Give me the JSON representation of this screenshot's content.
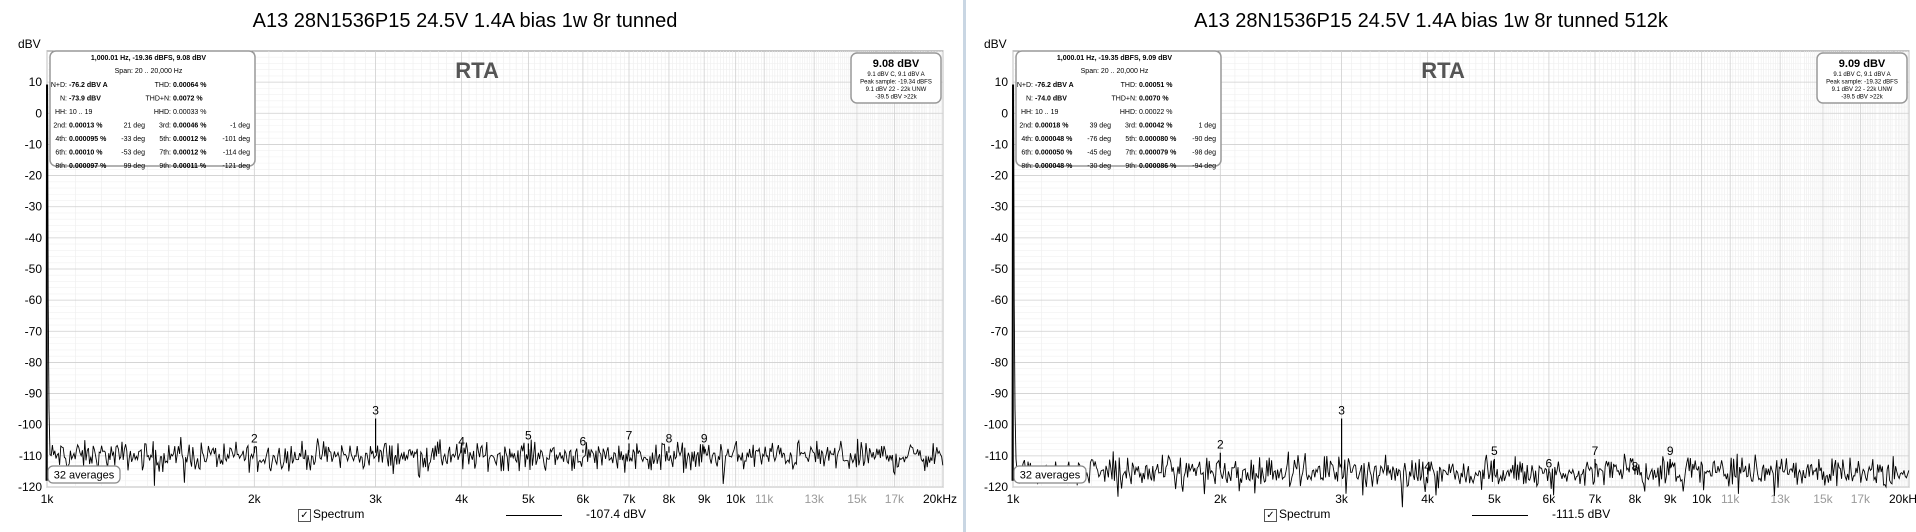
{
  "charts": [
    {
      "title": "A13 28N1536P15 24.5V 1.4A bias 1w 8r tunned",
      "unit_label": "dBV",
      "rta_label": "RTA",
      "averages_label": "32 averages",
      "spectrum_label": "Spectrum",
      "spectrum_value": "-107.4 dBV",
      "level_box": {
        "value": "9.08 dBV",
        "lines": [
          "9.1 dBV C, 9.1 dBV A",
          "Peak sample: -19.34 dBFS",
          "9.1 dBV 22 - 22k UNW",
          "-39.5 dBV >22k"
        ]
      },
      "info_box": {
        "header": "1,000.01 Hz, -19.36 dBFS, 9.08 dBV",
        "span": "Span: 20 .. 20,000 Hz",
        "rows": [
          [
            "N+D:",
            "-76.2 dBV A",
            "",
            "THD:",
            "0.00064 %",
            ""
          ],
          [
            "N:",
            "-73.9 dBV",
            "",
            "THD+N:",
            "0.0072 %",
            ""
          ],
          [
            "HH:",
            "10 .. 19",
            "",
            "HHD:",
            "0.00033 %",
            ""
          ],
          [
            "2nd:",
            "0.00013 %",
            "21 deg",
            "3rd:",
            "0.00046 %",
            "-1 deg"
          ],
          [
            "4th:",
            "0.000095 %",
            "-33 deg",
            "5th:",
            "0.00012 %",
            "-101 deg"
          ],
          [
            "6th:",
            "0.00010 %",
            "-53 deg",
            "7th:",
            "0.00012 %",
            "-114 deg"
          ],
          [
            "8th:",
            "0.000097 %",
            "99 deg",
            "9th:",
            "0.00011 %",
            "-121 deg"
          ]
        ]
      },
      "chart_data": {
        "type": "line",
        "title": "A13 28N1536P15 24.5V 1.4A bias 1w 8r tunned",
        "ylabel": "dBV",
        "ylim": [
          -120,
          20
        ],
        "xlim": [
          1000,
          20000
        ],
        "x_scale": "log",
        "grid": true,
        "y_ticks": [
          10,
          0,
          -10,
          -20,
          -30,
          -40,
          -50,
          -60,
          -70,
          -80,
          -90,
          -100,
          -110,
          -120
        ],
        "x_ticks": [
          {
            "v": 1000,
            "label": "1k",
            "major": true
          },
          {
            "v": 2000,
            "label": "2k",
            "major": true
          },
          {
            "v": 3000,
            "label": "3k",
            "major": true
          },
          {
            "v": 4000,
            "label": "4k",
            "major": true
          },
          {
            "v": 5000,
            "label": "5k",
            "major": true
          },
          {
            "v": 6000,
            "label": "6k",
            "major": true
          },
          {
            "v": 7000,
            "label": "7k",
            "major": true
          },
          {
            "v": 8000,
            "label": "8k",
            "major": true
          },
          {
            "v": 9000,
            "label": "9k",
            "major": true
          },
          {
            "v": 10000,
            "label": "10k",
            "major": true
          },
          {
            "v": 11000,
            "label": "11k",
            "major": false
          },
          {
            "v": 13000,
            "label": "13k",
            "major": false
          },
          {
            "v": 15000,
            "label": "15k",
            "major": false
          },
          {
            "v": 17000,
            "label": "17k",
            "major": false
          },
          {
            "v": 20000,
            "label": "20kHz",
            "major": true
          }
        ],
        "noise_floor_dbv": -110,
        "fundamental": {
          "x": 1000,
          "y": 9.08
        },
        "harmonics": [
          {
            "label": "2",
            "x": 2000,
            "y": -107
          },
          {
            "label": "3",
            "x": 3000,
            "y": -98
          },
          {
            "label": "4",
            "x": 4000,
            "y": -108
          },
          {
            "label": "5",
            "x": 5000,
            "y": -106
          },
          {
            "label": "6",
            "x": 6000,
            "y": -108
          },
          {
            "label": "7",
            "x": 7000,
            "y": -106
          },
          {
            "label": "8",
            "x": 8000,
            "y": -107
          },
          {
            "label": "9",
            "x": 9000,
            "y": -107
          }
        ]
      }
    },
    {
      "title": "A13 28N1536P15 24.5V 1.4A bias 1w 8r tunned 512k",
      "unit_label": "dBV",
      "rta_label": "RTA",
      "averages_label": "32 averages",
      "spectrum_label": "Spectrum",
      "spectrum_value": "-111.5 dBV",
      "level_box": {
        "value": "9.09 dBV",
        "lines": [
          "9.1 dBV C, 9.1 dBV A",
          "Peak sample: -19.32 dBFS",
          "9.1 dBV 22 - 22k UNW",
          "-39.5 dBV >22k"
        ]
      },
      "info_box": {
        "header": "1,000.01 Hz, -19.35 dBFS, 9.09 dBV",
        "span": "Span: 20 .. 20,000 Hz",
        "rows": [
          [
            "N+D:",
            "-76.2 dBV A",
            "",
            "THD:",
            "0.00051 %",
            ""
          ],
          [
            "N:",
            "-74.0 dBV",
            "",
            "THD+N:",
            "0.0070 %",
            ""
          ],
          [
            "HH:",
            "10 .. 19",
            "",
            "HHD:",
            "0.00022 %",
            ""
          ],
          [
            "2nd:",
            "0.00018 %",
            "39 deg",
            "3rd:",
            "0.00042 %",
            "1 deg"
          ],
          [
            "4th:",
            "0.000048 %",
            "-76 deg",
            "5th:",
            "0.000080 %",
            "-90 deg"
          ],
          [
            "6th:",
            "0.000050 %",
            "-45 deg",
            "7th:",
            "0.000079 %",
            "-98 deg"
          ],
          [
            "8th:",
            "0.000048 %",
            "-30 deg",
            "9th:",
            "0.000086 %",
            "-94 deg"
          ]
        ]
      },
      "chart_data": {
        "type": "line",
        "title": "A13 28N1536P15 24.5V 1.4A bias 1w 8r tunned 512k",
        "ylabel": "dBV",
        "ylim": [
          -120,
          20
        ],
        "xlim": [
          1000,
          20000
        ],
        "x_scale": "log",
        "grid": true,
        "y_ticks": [
          10,
          0,
          -10,
          -20,
          -30,
          -40,
          -50,
          -60,
          -70,
          -80,
          -90,
          -100,
          -110,
          -120
        ],
        "x_ticks": [
          {
            "v": 1000,
            "label": "1k",
            "major": true
          },
          {
            "v": 2000,
            "label": "2k",
            "major": true
          },
          {
            "v": 3000,
            "label": "3k",
            "major": true
          },
          {
            "v": 4000,
            "label": "4k",
            "major": true
          },
          {
            "v": 5000,
            "label": "5k",
            "major": true
          },
          {
            "v": 6000,
            "label": "6k",
            "major": true
          },
          {
            "v": 7000,
            "label": "7k",
            "major": true
          },
          {
            "v": 8000,
            "label": "8k",
            "major": true
          },
          {
            "v": 9000,
            "label": "9k",
            "major": true
          },
          {
            "v": 10000,
            "label": "10k",
            "major": true
          },
          {
            "v": 11000,
            "label": "11k",
            "major": false
          },
          {
            "v": 13000,
            "label": "13k",
            "major": false
          },
          {
            "v": 15000,
            "label": "15k",
            "major": false
          },
          {
            "v": 17000,
            "label": "17k",
            "major": false
          },
          {
            "v": 20000,
            "label": "20kHz",
            "major": true
          }
        ],
        "noise_floor_dbv": -115,
        "fundamental": {
          "x": 1000,
          "y": 9.09
        },
        "harmonics": [
          {
            "label": "2",
            "x": 2000,
            "y": -109
          },
          {
            "label": "3",
            "x": 3000,
            "y": -98
          },
          {
            "label": "4",
            "x": 4000,
            "y": -116
          },
          {
            "label": "5",
            "x": 5000,
            "y": -111
          },
          {
            "label": "6",
            "x": 6000,
            "y": -115
          },
          {
            "label": "7",
            "x": 7000,
            "y": -111
          },
          {
            "label": "8",
            "x": 8000,
            "y": -116
          },
          {
            "label": "9",
            "x": 9000,
            "y": -111
          }
        ]
      }
    }
  ]
}
